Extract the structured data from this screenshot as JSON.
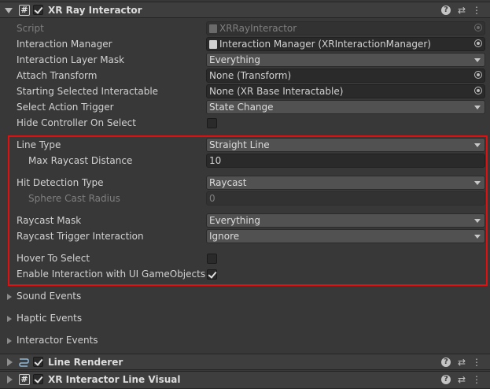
{
  "components": {
    "ray_interactor": {
      "title": "XR Ray Interactor",
      "enabled": true
    },
    "line_renderer": {
      "title": "Line Renderer",
      "enabled": true
    },
    "line_visual": {
      "title": "XR Interactor Line Visual",
      "enabled": true
    }
  },
  "fields": {
    "script": {
      "label": "Script",
      "value": "XRRayInteractor"
    },
    "interaction_manager": {
      "label": "Interaction Manager",
      "value": "Interaction Manager (XRInteractionManager)"
    },
    "interaction_layer_mask": {
      "label": "Interaction Layer Mask",
      "value": "Everything"
    },
    "attach_transform": {
      "label": "Attach Transform",
      "value": "None (Transform)"
    },
    "starting_selected_interactable": {
      "label": "Starting Selected Interactable",
      "value": "None (XR Base Interactable)"
    },
    "select_action_trigger": {
      "label": "Select Action Trigger",
      "value": "State Change"
    },
    "hide_controller_on_select": {
      "label": "Hide Controller On Select",
      "checked": false
    },
    "line_type": {
      "label": "Line Type",
      "value": "Straight Line"
    },
    "max_raycast_distance": {
      "label": "Max Raycast Distance",
      "value": "10"
    },
    "hit_detection_type": {
      "label": "Hit Detection Type",
      "value": "Raycast"
    },
    "sphere_cast_radius": {
      "label": "Sphere Cast Radius",
      "value": "0"
    },
    "raycast_mask": {
      "label": "Raycast Mask",
      "value": "Everything"
    },
    "raycast_trigger_interaction": {
      "label": "Raycast Trigger Interaction",
      "value": "Ignore"
    },
    "hover_to_select": {
      "label": "Hover To Select",
      "checked": false
    },
    "enable_ui_interaction": {
      "label": "Enable Interaction with UI GameObjects",
      "checked": true
    }
  },
  "foldouts": {
    "sound_events": "Sound Events",
    "haptic_events": "Haptic Events",
    "interactor_events": "Interactor Events"
  },
  "header_tools": {
    "help": "?",
    "presets": "⇄",
    "menu": "⋮"
  },
  "colors": {
    "highlight": "#e01010",
    "background": "#383838",
    "header": "#3e3e3e"
  }
}
